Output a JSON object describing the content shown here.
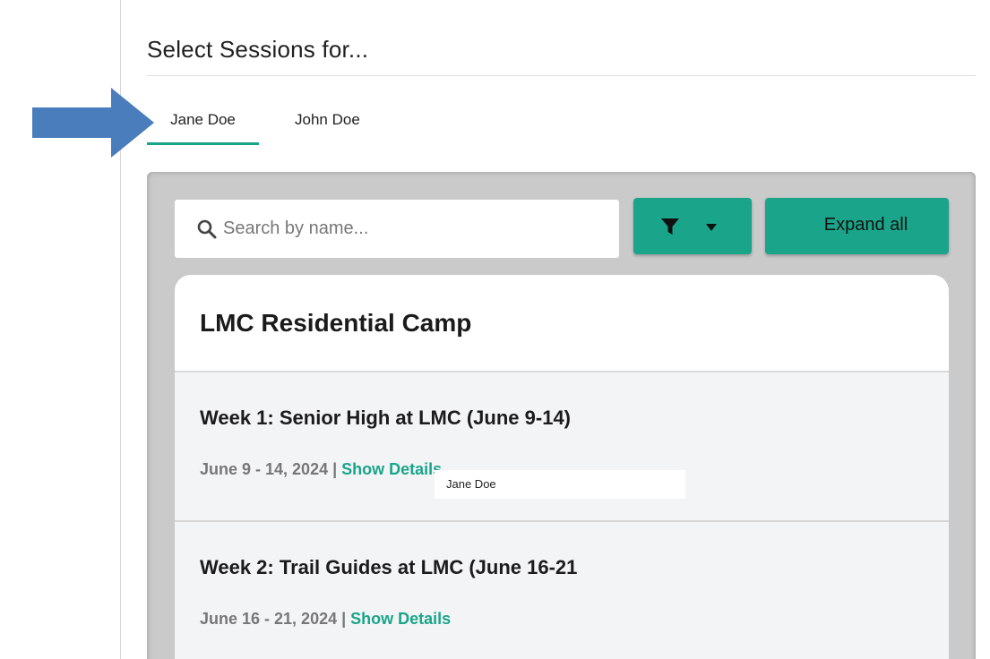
{
  "page": {
    "title": "Select Sessions for..."
  },
  "tabs": [
    {
      "label": "Jane Doe",
      "active": true
    },
    {
      "label": "John Doe",
      "active": false
    }
  ],
  "search": {
    "placeholder": "Search by name...",
    "value": "",
    "icon": "search-icon"
  },
  "filter": {
    "icon": "filter-icon",
    "caret_icon": "caret-down-icon"
  },
  "expand": {
    "label": "Expand all"
  },
  "program": {
    "title": "LMC Residential Camp",
    "sessions": [
      {
        "name": "Week 1: Senior High at LMC (June 9-14)",
        "dates": "June 9 - 14, 2024",
        "separator": " | ",
        "details_label": "Show Details"
      },
      {
        "name": "Week 2: Trail Guides at LMC (June 16-21",
        "dates": "June 16 - 21, 2024",
        "separator": " | ",
        "details_label": "Show Details"
      }
    ]
  },
  "overlay": {
    "label": "Jane Doe"
  },
  "annotation": {
    "arrow_icon": "arrow-right-icon",
    "arrow_color": "#4a7dbb"
  },
  "colors": {
    "accent": "#1aa58a",
    "panel": "#c9cac9",
    "card": "#f3f4f5",
    "muted_text": "#777777"
  }
}
